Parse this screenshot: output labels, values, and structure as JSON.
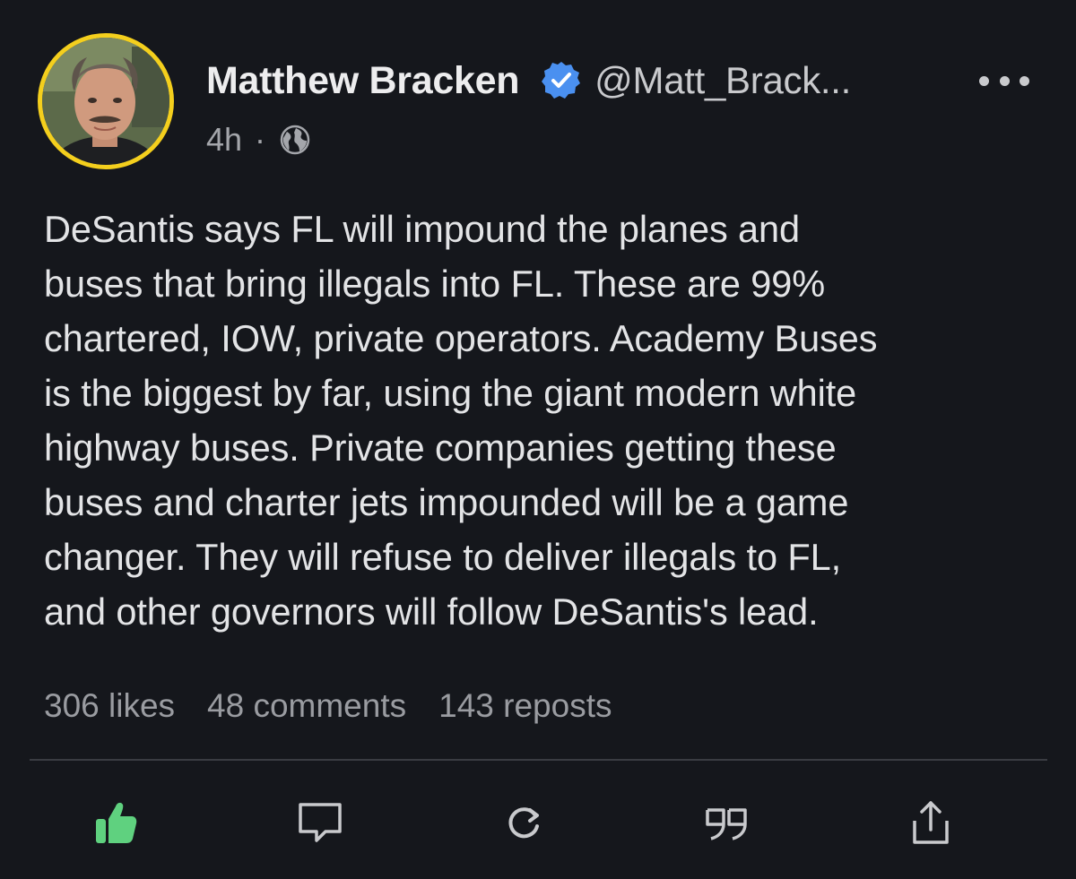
{
  "author": {
    "name": "Matthew Bracken",
    "handle": "@Matt_Brack...",
    "verified": true,
    "avatar_border_color": "#f4cf1d"
  },
  "meta": {
    "time": "4h",
    "separator": "·",
    "visibility_icon": "globe-icon"
  },
  "post": {
    "lines": [
      "DeSantis says FL will impound the planes and",
      "buses that bring illegals into FL. These are 99%",
      "chartered, IOW, private operators. Academy Buses",
      "is the biggest by far, using the giant modern white",
      "highway buses. Private companies getting these",
      "buses and charter jets impounded will be a game",
      "changer. They will refuse to deliver illegals to FL,",
      "and other governors will follow DeSantis's lead."
    ]
  },
  "stats": {
    "likes": "306 likes",
    "comments": "48 comments",
    "reposts": "143 reposts"
  },
  "actions": [
    {
      "name": "like",
      "icon": "thumbs-up-icon",
      "active": true,
      "color": "#5fd17f"
    },
    {
      "name": "comment",
      "icon": "comment-bubble-icon",
      "active": false,
      "color": "#c9cacd"
    },
    {
      "name": "repost",
      "icon": "repost-icon",
      "active": false,
      "color": "#c9cacd"
    },
    {
      "name": "quote",
      "icon": "quote-icon",
      "active": false,
      "color": "#c9cacd"
    },
    {
      "name": "share",
      "icon": "share-icon",
      "active": false,
      "color": "#c9cacd"
    }
  ],
  "colors": {
    "background": "#15171c",
    "verified_badge": "#4a90f0",
    "like_active": "#5fd17f"
  }
}
